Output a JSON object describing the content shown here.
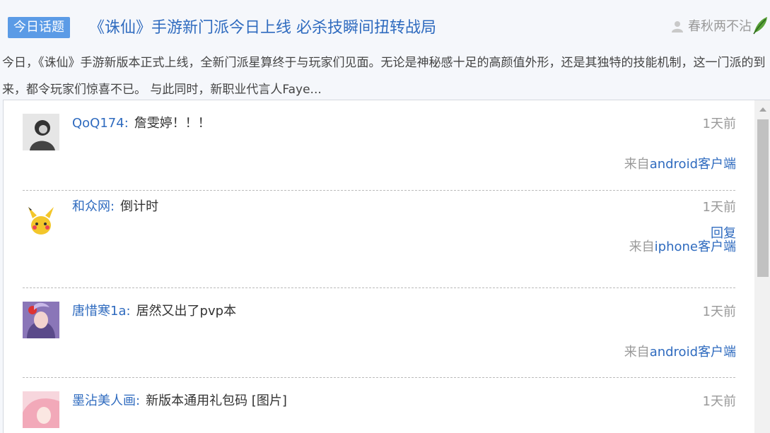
{
  "topic": {
    "badge": "今日话题",
    "title": "《诛仙》手游新门派今日上线 必杀技瞬间扭转战局",
    "author": "春秋两不沾",
    "summary": "今日，《诛仙》手游新版本正式上线，全新门派星算终于与玩家们见面。无论是神秘感十足的高颜值外形，还是其独特的技能机制，这一门派的到来，都令玩家们惊喜不已。 与此同时，新职业代言人Faye..."
  },
  "comments": [
    {
      "user": "QoQ174",
      "colon": ":",
      "text": "詹雯婷！！！",
      "time": "1天前",
      "source_prefix": "来自",
      "client": "android客户端",
      "reply": ""
    },
    {
      "user": "和众网",
      "colon": ":",
      "text": "倒计时",
      "time": "1天前",
      "source_prefix": "来自",
      "client": "iphone客户端",
      "reply": "回复"
    },
    {
      "user": "唐惜寒1a",
      "colon": ":",
      "text": "居然又出了pvp本",
      "time": "1天前",
      "source_prefix": "来自",
      "client": "android客户端",
      "reply": ""
    },
    {
      "user": "墨沾美人画",
      "colon": ":",
      "text": "新版本通用礼包码 [图片]",
      "time": "1天前",
      "source_prefix": "",
      "client": "",
      "reply": ""
    }
  ]
}
